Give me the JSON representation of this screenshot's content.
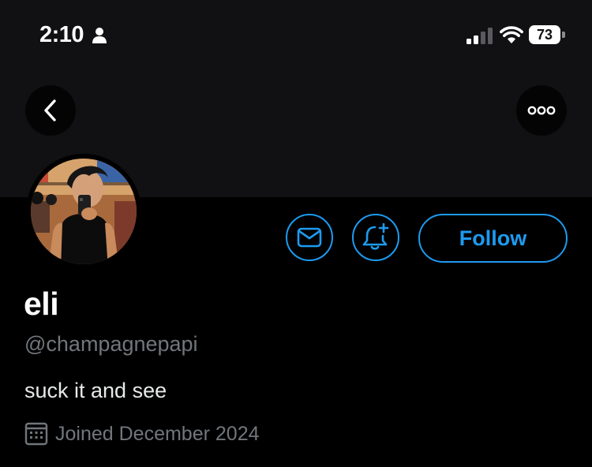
{
  "status_bar": {
    "time": "2:10",
    "battery": "73"
  },
  "header": {
    "icons": {
      "back": "chevron-left-icon",
      "more": "ellipsis-icon"
    }
  },
  "profile": {
    "display_name": "eli",
    "handle": "@champagnepapi",
    "bio": "suck it and see",
    "joined": "Joined December 2024",
    "follow_label": "Follow"
  },
  "colors": {
    "accent": "#1d9bf0",
    "secondary_text": "#71767b",
    "background": "#000000",
    "banner": "#111113"
  }
}
